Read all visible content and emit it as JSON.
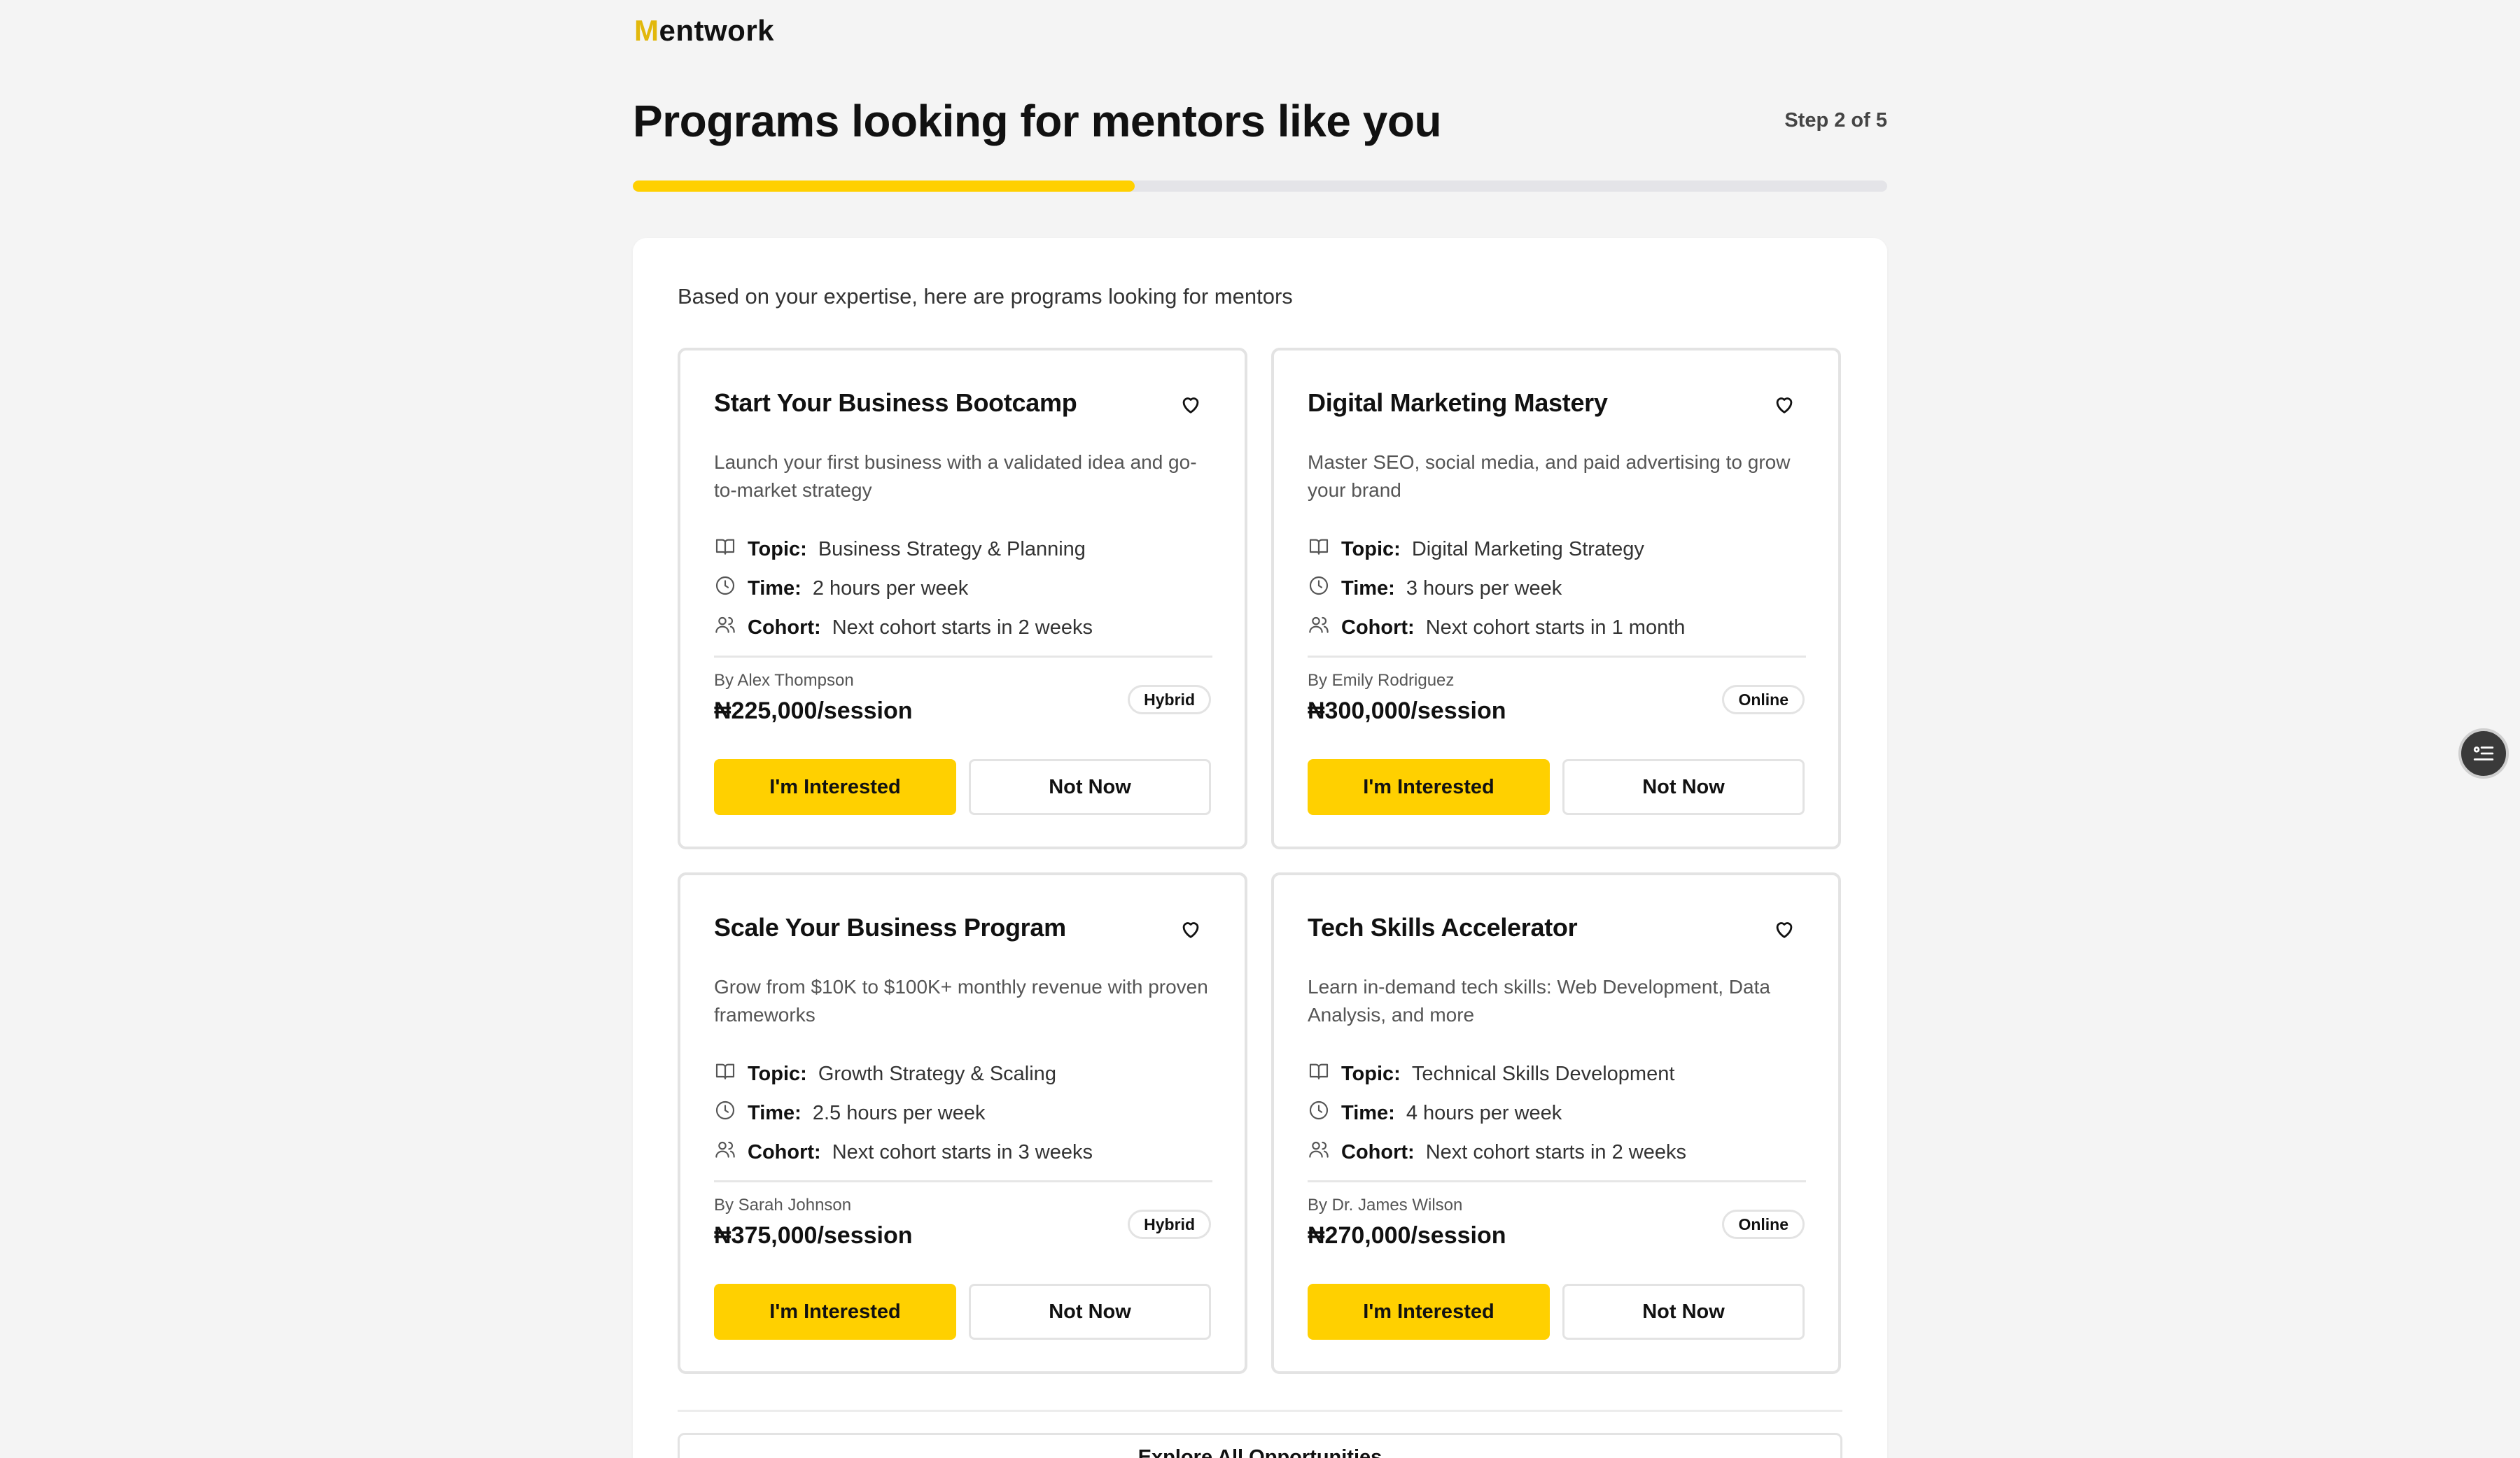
{
  "brand": {
    "first_letter": "M",
    "rest": "entwork"
  },
  "header": {
    "title": "Programs looking for mentors like you",
    "step": "Step 2 of 5",
    "progress_fraction": 0.4
  },
  "intro": "Based on your expertise, here are programs looking for mentors",
  "labels": {
    "topic": "Topic:",
    "time": "Time:",
    "cohort": "Cohort:",
    "interested": "I'm Interested",
    "not_now": "Not Now"
  },
  "programs": [
    {
      "title": "Start Your Business Bootcamp",
      "description": "Launch your first business with a validated idea and go-to-market strategy",
      "topic": "Business Strategy & Planning",
      "time": "2 hours per week",
      "cohort": "Next cohort starts in 2 weeks",
      "author": "By Alex Thompson",
      "price": "₦225,000/session",
      "mode": "Hybrid"
    },
    {
      "title": "Digital Marketing Mastery",
      "description": "Master SEO, social media, and paid advertising to grow your brand",
      "topic": "Digital Marketing Strategy",
      "time": "3 hours per week",
      "cohort": "Next cohort starts in 1 month",
      "author": "By Emily Rodriguez",
      "price": "₦300,000/session",
      "mode": "Online"
    },
    {
      "title": "Scale Your Business Program",
      "description": "Grow from $10K to $100K+ monthly revenue with proven frameworks",
      "topic": "Growth Strategy & Scaling",
      "time": "2.5 hours per week",
      "cohort": "Next cohort starts in 3 weeks",
      "author": "By Sarah Johnson",
      "price": "₦375,000/session",
      "mode": "Hybrid"
    },
    {
      "title": "Tech Skills Accelerator",
      "description": "Learn in-demand tech skills: Web Development, Data Analysis, and more",
      "topic": "Technical Skills Development",
      "time": "4 hours per week",
      "cohort": "Next cohort starts in 2 weeks",
      "author": "By Dr. James Wilson",
      "price": "₦270,000/session",
      "mode": "Online"
    }
  ],
  "explore_label": "Explore All Opportunities",
  "colors": {
    "accent": "#ffd000",
    "logo_accent": "#e2b80c"
  },
  "icons": [
    "heart-icon",
    "book-icon",
    "clock-icon",
    "users-icon",
    "list-icon"
  ]
}
